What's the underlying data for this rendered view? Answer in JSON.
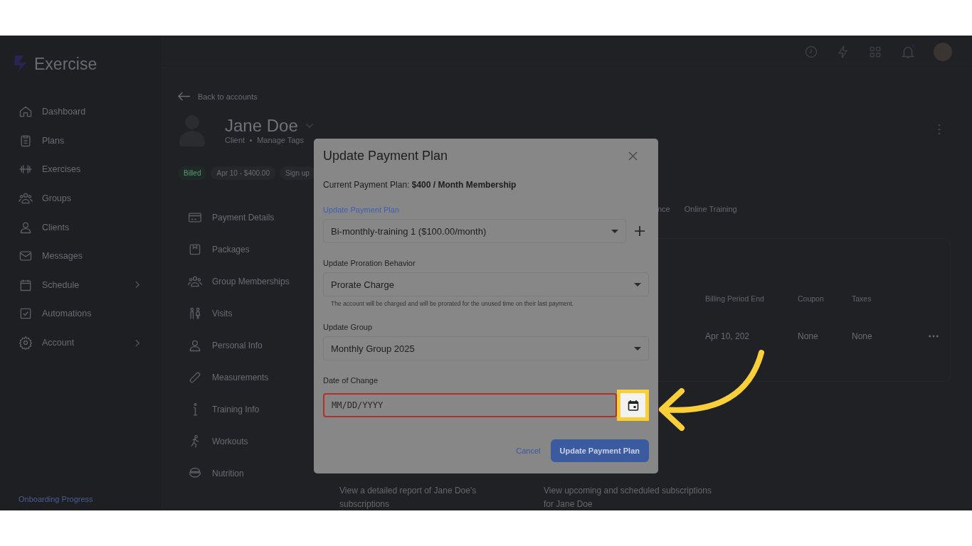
{
  "app": {
    "logo": "Exercise"
  },
  "sidebar": {
    "items": [
      {
        "label": "Dashboard",
        "expandable": false
      },
      {
        "label": "Plans",
        "expandable": false
      },
      {
        "label": "Exercises",
        "expandable": false
      },
      {
        "label": "Groups",
        "expandable": false
      },
      {
        "label": "Clients",
        "expandable": false
      },
      {
        "label": "Messages",
        "expandable": false
      },
      {
        "label": "Schedule",
        "expandable": true
      },
      {
        "label": "Automations",
        "expandable": false
      },
      {
        "label": "Account",
        "expandable": true
      }
    ],
    "footer": "Onboarding Progress"
  },
  "account": {
    "back_link": "Back to accounts",
    "name": "Jane Doe",
    "role": "Client",
    "tags_link": "Manage Tags",
    "chips": [
      {
        "label": "Billed",
        "kind": "status"
      },
      {
        "label": "Apr 10 - $400.00",
        "kind": "plain"
      },
      {
        "label": "Sign up",
        "kind": "plain"
      }
    ]
  },
  "sections": [
    {
      "label": "Payment Details"
    },
    {
      "label": "Packages"
    },
    {
      "label": "Group Memberships"
    },
    {
      "label": "Visits"
    },
    {
      "label": "Personal Info"
    },
    {
      "label": "Measurements"
    },
    {
      "label": "Training Info"
    },
    {
      "label": "Workouts"
    },
    {
      "label": "Nutrition"
    }
  ],
  "tabs": [
    {
      "label": "nce"
    },
    {
      "label": "Online Training"
    }
  ],
  "table": {
    "columns": [
      "Billing Period End",
      "Coupon",
      "Taxes"
    ],
    "rows": [
      [
        "Apr 10, 202",
        "None",
        "None"
      ]
    ]
  },
  "cards": [
    {
      "text": "View a detailed report of Jane Doe's subscriptions"
    },
    {
      "text": "View upcoming and scheduled subscriptions for Jane Doe"
    }
  ],
  "modal": {
    "title": "Update Payment Plan",
    "current_plan": "Current Payment Plan: **$400 / Month Membership**",
    "fields": [
      {
        "kind": "select",
        "label": "Update Payment Plan",
        "value": "Bi-monthly-training 1 ($100.00/month)",
        "focused": true,
        "error": false,
        "add_button": true
      },
      {
        "kind": "select",
        "label": "Update Proration Behavior",
        "value": "Prorate Charge",
        "help": "The account will be charged and will be prorated for the unused time on their last payment.",
        "focused": false,
        "error": false,
        "add_button": false
      },
      {
        "kind": "select",
        "label": "Update Group",
        "value": "Monthly Group 2025",
        "focused": false,
        "error": false,
        "add_button": false
      },
      {
        "kind": "date",
        "label": "Date of Change",
        "placeholder": "MM/DD/YYYY",
        "focused": false,
        "error": true,
        "add_button": false
      }
    ],
    "cancel": "Cancel",
    "submit": "Update Payment Plan"
  }
}
